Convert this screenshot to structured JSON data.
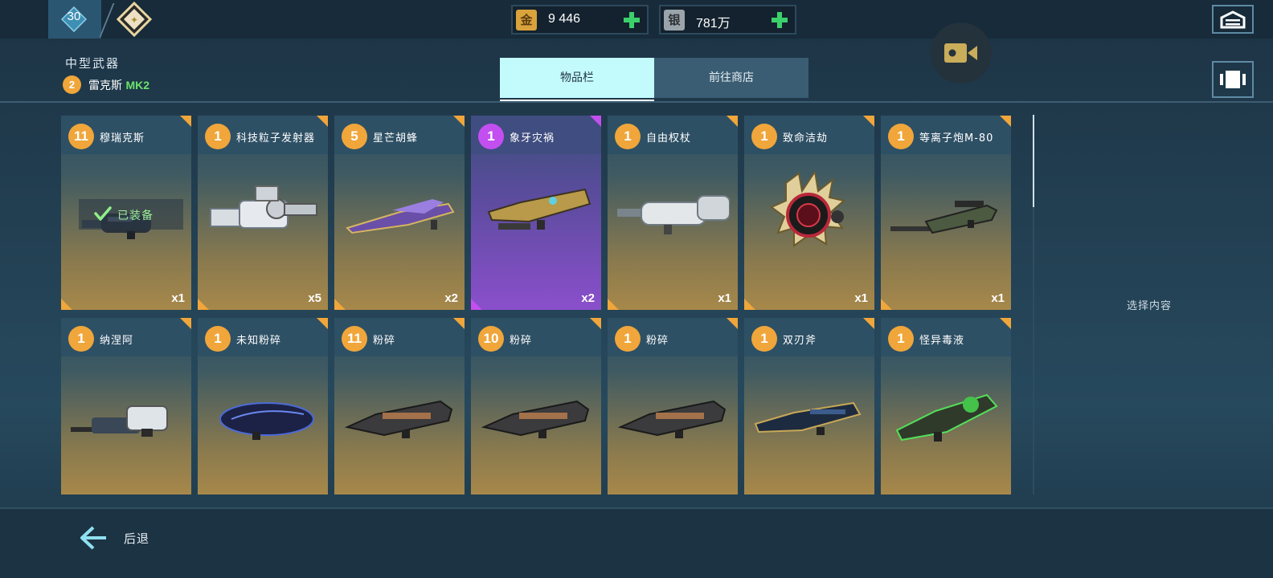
{
  "player": {
    "level": "30"
  },
  "currencies": [
    {
      "icon": "金",
      "value": "9 446"
    },
    {
      "icon": "银",
      "value": "781万"
    }
  ],
  "header": {
    "category": "中型武器",
    "slot_number": "2",
    "weapon_name": "雷克斯",
    "weapon_variant": "MK2"
  },
  "tabs": [
    {
      "label": "物品栏",
      "active": true
    },
    {
      "label": "前往商店",
      "active": false
    }
  ],
  "equipped_label": "已装备",
  "detail_placeholder": "选择内容",
  "back_label": "后退",
  "colors": {
    "accent_orange": "#f0a63a",
    "accent_purple": "#c34ff0",
    "tab_active_bg": "#c3fbfd",
    "plus_green": "#3bd16a",
    "equipped_green": "#9ff09a"
  },
  "items_row1": [
    {
      "count": "11",
      "name": "穆瑞克斯",
      "qty": "x1",
      "rarity": "orange",
      "equipped": true,
      "icon": "dark-compact-gun-icon"
    },
    {
      "count": "1",
      "name": "科技粒子发射器",
      "qty": "x5",
      "rarity": "orange",
      "icon": "white-particle-launcher-icon"
    },
    {
      "count": "5",
      "name": "星芒胡蜂",
      "qty": "x2",
      "rarity": "orange",
      "icon": "purple-gold-rifle-icon"
    },
    {
      "count": "1",
      "name": "象牙灾祸",
      "qty": "x2",
      "rarity": "purple",
      "icon": "gold-cannon-icon"
    },
    {
      "count": "1",
      "name": "自由权杖",
      "qty": "x1",
      "rarity": "orange",
      "icon": "white-cannon-icon"
    },
    {
      "count": "1",
      "name": "致命洁劫",
      "qty": "x1",
      "rarity": "orange",
      "icon": "red-disc-launcher-icon"
    },
    {
      "count": "1",
      "name": "等离子炮M-80",
      "qty": "x1",
      "rarity": "orange",
      "icon": "sniper-rifle-icon"
    }
  ],
  "items_row2": [
    {
      "count": "1",
      "name": "纳涅阿",
      "rarity": "orange",
      "icon": "white-assault-rifle-icon"
    },
    {
      "count": "1",
      "name": "未知粉碎",
      "rarity": "orange",
      "icon": "blue-pod-gun-icon"
    },
    {
      "count": "11",
      "name": "粉碎",
      "rarity": "orange",
      "icon": "shotgun-cannon-icon"
    },
    {
      "count": "10",
      "name": "粉碎",
      "rarity": "orange",
      "icon": "shotgun-cannon-icon"
    },
    {
      "count": "1",
      "name": "粉碎",
      "rarity": "orange",
      "icon": "shotgun-cannon-icon"
    },
    {
      "count": "1",
      "name": "双刃斧",
      "rarity": "orange",
      "icon": "blue-gold-gun-icon"
    },
    {
      "count": "1",
      "name": "怪异毒液",
      "rarity": "orange",
      "icon": "green-toxic-gun-icon"
    }
  ]
}
